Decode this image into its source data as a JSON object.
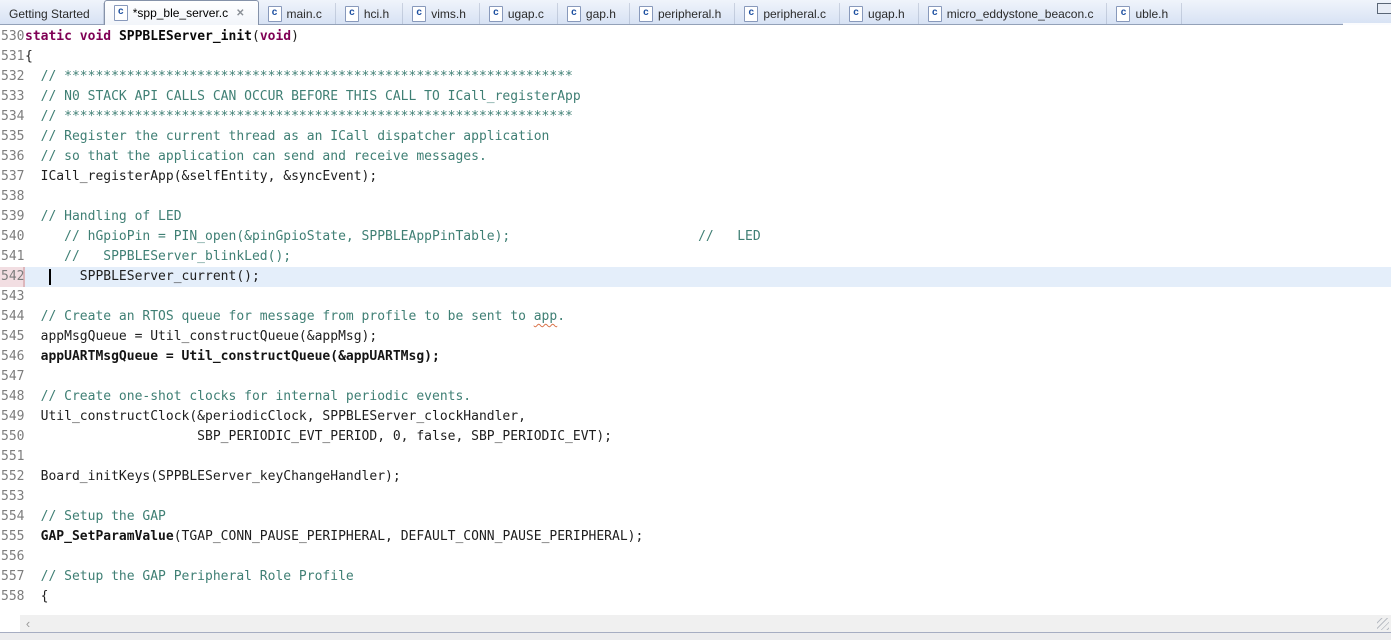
{
  "tab_bar": {
    "file_icon_letter": "c",
    "close_glyph": "✕",
    "tabs": [
      {
        "label": "Getting Started",
        "icon": false,
        "active": false,
        "closable": false
      },
      {
        "label": "*spp_ble_server.c",
        "icon": true,
        "active": true,
        "closable": true
      },
      {
        "label": "main.c",
        "icon": true,
        "active": false,
        "closable": false
      },
      {
        "label": "hci.h",
        "icon": true,
        "active": false,
        "closable": false
      },
      {
        "label": "vims.h",
        "icon": true,
        "active": false,
        "closable": false
      },
      {
        "label": "ugap.c",
        "icon": true,
        "active": false,
        "closable": false
      },
      {
        "label": "gap.h",
        "icon": true,
        "active": false,
        "closable": false
      },
      {
        "label": "peripheral.h",
        "icon": true,
        "active": false,
        "closable": false
      },
      {
        "label": "peripheral.c",
        "icon": true,
        "active": false,
        "closable": false
      },
      {
        "label": "ugap.h",
        "icon": true,
        "active": false,
        "closable": false
      },
      {
        "label": "micro_eddystone_beacon.c",
        "icon": true,
        "active": false,
        "closable": false
      },
      {
        "label": "uble.h",
        "icon": true,
        "active": false,
        "closable": false
      }
    ]
  },
  "editor": {
    "current_line": 542,
    "caret_line": 542,
    "lines": [
      {
        "num": 530,
        "segments": [
          {
            "t": "static",
            "type": "keyword"
          },
          {
            "t": " ",
            "type": "plain"
          },
          {
            "t": "void",
            "type": "keyword"
          },
          {
            "t": " ",
            "type": "plain"
          },
          {
            "t": "SPPBLEServer_init",
            "type": "function"
          },
          {
            "t": "(",
            "type": "plain"
          },
          {
            "t": "void",
            "type": "keyword"
          },
          {
            "t": ")",
            "type": "plain"
          }
        ]
      },
      {
        "num": 531,
        "segments": [
          {
            "t": "{",
            "type": "plain"
          }
        ]
      },
      {
        "num": 532,
        "segments": [
          {
            "t": "  // *****************************************************************",
            "type": "comment"
          }
        ]
      },
      {
        "num": 533,
        "segments": [
          {
            "t": "  // N0 STACK API CALLS CAN OCCUR BEFORE THIS CALL TO ICall_registerApp",
            "type": "comment"
          }
        ]
      },
      {
        "num": 534,
        "segments": [
          {
            "t": "  // *****************************************************************",
            "type": "comment"
          }
        ]
      },
      {
        "num": 535,
        "segments": [
          {
            "t": "  // Register the current thread as an ICall dispatcher application",
            "type": "comment"
          }
        ]
      },
      {
        "num": 536,
        "segments": [
          {
            "t": "  // so that the application can send and receive messages.",
            "type": "comment"
          }
        ]
      },
      {
        "num": 537,
        "segments": [
          {
            "t": "  ICall_registerApp(&selfEntity, &syncEvent);",
            "type": "plain"
          }
        ]
      },
      {
        "num": 538,
        "segments": []
      },
      {
        "num": 539,
        "segments": [
          {
            "t": "  // Handling of LED",
            "type": "comment"
          }
        ]
      },
      {
        "num": 540,
        "segments": [
          {
            "t": "     // hGpioPin = PIN_open(&pinGpioState, SPPBLEAppPinTable);                        //   LED",
            "type": "comment"
          }
        ]
      },
      {
        "num": 541,
        "segments": [
          {
            "t": "     //   SPPBLEServer_blinkLed();",
            "type": "comment"
          }
        ]
      },
      {
        "num": 542,
        "segments": [
          {
            "t": "       SPPBLEServer_current();",
            "type": "plain"
          }
        ]
      },
      {
        "num": 543,
        "segments": []
      },
      {
        "num": 544,
        "segments": [
          {
            "t": "  // Create an RTOS queue for message from profile to be sent to ",
            "type": "comment"
          },
          {
            "t": "app",
            "type": "comment-misspelled"
          },
          {
            "t": ".",
            "type": "comment"
          }
        ]
      },
      {
        "num": 545,
        "segments": [
          {
            "t": "  appMsgQueue = Util_constructQueue(&appMsg);",
            "type": "plain"
          }
        ]
      },
      {
        "num": 546,
        "segments": [
          {
            "t": "  appUARTMsgQueue = Util_constructQueue(&appUARTMsg);",
            "type": "plain-bold"
          }
        ]
      },
      {
        "num": 547,
        "segments": []
      },
      {
        "num": 548,
        "segments": [
          {
            "t": "  // Create one-shot clocks for internal periodic events.",
            "type": "comment"
          }
        ]
      },
      {
        "num": 549,
        "segments": [
          {
            "t": "  Util_constructClock(&periodicClock, SPPBLEServer_clockHandler,",
            "type": "plain"
          }
        ]
      },
      {
        "num": 550,
        "segments": [
          {
            "t": "                      SBP_PERIODIC_EVT_PERIOD, 0, false, SBP_PERIODIC_EVT);",
            "type": "plain"
          }
        ]
      },
      {
        "num": 551,
        "segments": []
      },
      {
        "num": 552,
        "segments": [
          {
            "t": "  Board_initKeys(SPPBLEServer_keyChangeHandler);",
            "type": "plain"
          }
        ]
      },
      {
        "num": 553,
        "segments": []
      },
      {
        "num": 554,
        "segments": [
          {
            "t": "  // Setup the GAP",
            "type": "comment"
          }
        ]
      },
      {
        "num": 555,
        "segments": [
          {
            "t": "  ",
            "type": "plain"
          },
          {
            "t": "GAP_SetParamValue",
            "type": "plain-bold"
          },
          {
            "t": "(TGAP_CONN_PAUSE_PERIPHERAL, DEFAULT_CONN_PAUSE_PERIPHERAL);",
            "type": "plain"
          }
        ]
      },
      {
        "num": 556,
        "segments": []
      },
      {
        "num": 557,
        "segments": [
          {
            "t": "  // Setup the GAP Peripheral Role Profile",
            "type": "comment"
          }
        ]
      },
      {
        "num": 558,
        "segments": [
          {
            "t": "  {",
            "type": "plain"
          }
        ]
      }
    ]
  },
  "scrollbar": {
    "left_arrow": "‹"
  },
  "colors": {
    "keyword": "#7f0055",
    "comment": "#3f7f74",
    "plain_text": "#1e1e1e",
    "current_line_bg": "#e4eefa",
    "current_gutter_bg": "#f2dee2",
    "tabbar_bg_top": "#f0f4fb",
    "tabbar_bg_bottom": "#d7e2f4",
    "squiggle": "#d9734a"
  }
}
